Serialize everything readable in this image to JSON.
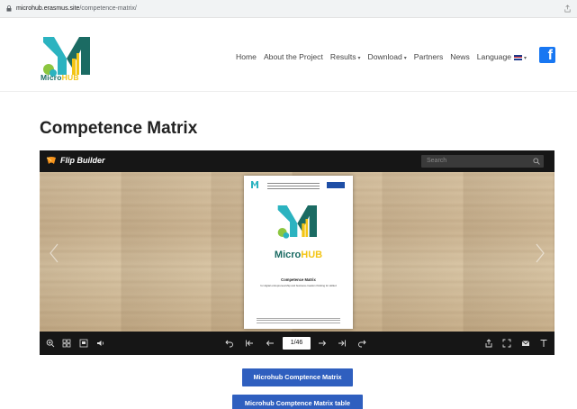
{
  "browser": {
    "url_host": "microhub.erasmus.site",
    "url_path": "/competence-matrix/"
  },
  "header": {
    "logo_word_1": "Micro",
    "logo_word_2": "HUB",
    "nav": [
      {
        "label": "Home"
      },
      {
        "label": "About the Project"
      },
      {
        "label": "Results",
        "caret": "▾"
      },
      {
        "label": "Download",
        "caret": "▾"
      },
      {
        "label": "Partners"
      },
      {
        "label": "News"
      },
      {
        "label": "Language",
        "caret": "▾"
      }
    ],
    "facebook_glyph": "f"
  },
  "page": {
    "title": "Competence Matrix"
  },
  "viewer": {
    "brand": "Flip Builder",
    "search_placeholder": "Search",
    "page_indicator": "1/46",
    "document": {
      "logo_word_1": "Micro",
      "logo_word_2": "HUB",
      "title": "Competence Matrix",
      "subtitle": "for digital entrepreneurship and business creation thinking for skilled"
    }
  },
  "buttons": {
    "matrix": "Microhub Comptence Matrix",
    "matrix_table": "Microhub Comptence Matrix table"
  },
  "colors": {
    "brand_teal": "#1b6b63",
    "brand_yellow": "#f3c515",
    "button_blue": "#2f5fbf",
    "facebook_blue": "#1877f2"
  }
}
